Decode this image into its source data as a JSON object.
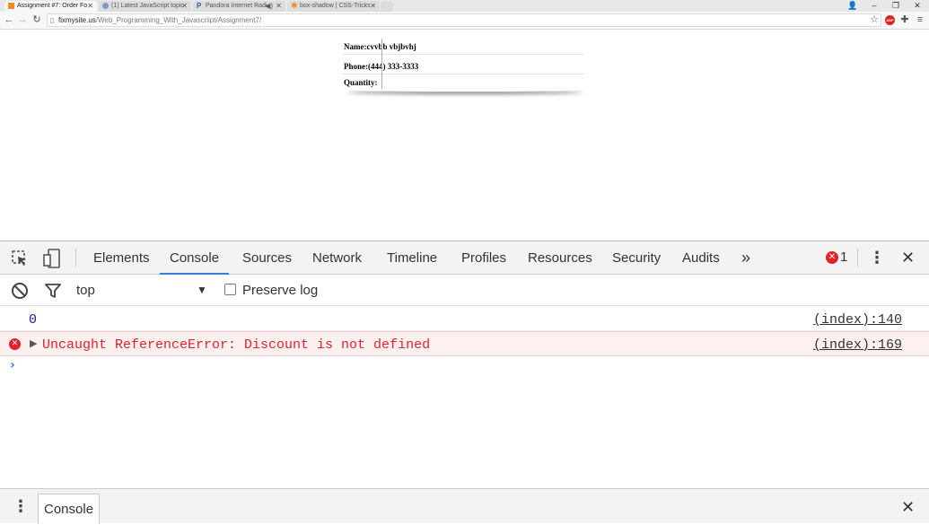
{
  "browser": {
    "tabs": [
      {
        "title": "Assignment #7: Order Fo",
        "active": true,
        "favicon_color": "#f08a24"
      },
      {
        "title": "(1) Latest JavaScript topic",
        "active": false,
        "favicon_color": "#7a9cc6"
      },
      {
        "title": "Pandora Internet Radi",
        "active": false,
        "favicon_color": "#2e5aa8"
      },
      {
        "title": "box-shadow | CSS-Tricks",
        "active": false,
        "favicon_color": "#f08a24"
      }
    ],
    "pandora_favicon_letter": "P",
    "url_host": "fixmysite.us",
    "url_path": "/Web_Programming_With_Javascriipt/Assignment7/",
    "abp_badge": "ABP"
  },
  "form": {
    "rows": [
      {
        "label": "Name:cvvbb vbjbvhj"
      },
      {
        "label": "Phone:(444) 333-3333"
      },
      {
        "label": "Quantity:"
      }
    ]
  },
  "devtools": {
    "tabs": [
      "Elements",
      "Console",
      "Sources",
      "Network",
      "Timeline",
      "Profiles",
      "Resources",
      "Security",
      "Audits"
    ],
    "more_label": "»",
    "active_tab": "Console",
    "error_count": "1",
    "context": "top",
    "preserve_log_label": "Preserve log",
    "console": [
      {
        "type": "log",
        "message": "0",
        "source": "(index):140"
      },
      {
        "type": "error",
        "message": "Uncaught ReferenceError: Discount is not defined",
        "source": "(index):169"
      }
    ],
    "drawer_tab": "Console",
    "colors": {
      "accent": "#3a7de0",
      "error": "#e0222a",
      "number": "#1a1aa6"
    }
  }
}
